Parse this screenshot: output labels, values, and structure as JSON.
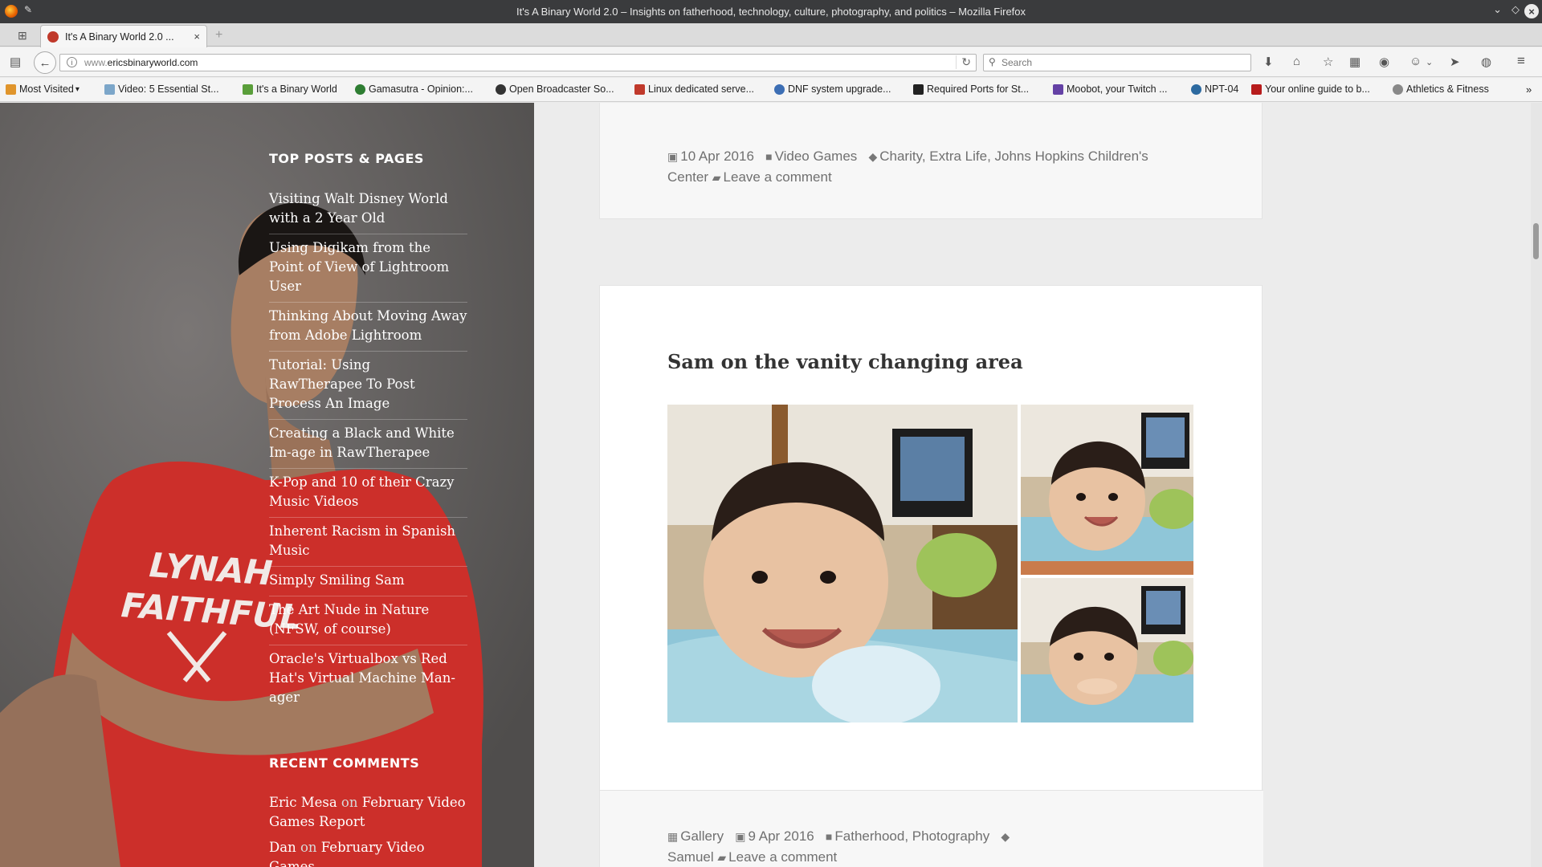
{
  "window": {
    "title": "It's A Binary World 2.0 – Insights on fatherhood, technology, culture, photography, and politics – Mozilla Firefox"
  },
  "tabs": [
    {
      "label": "It's A Binary World 2.0 ...",
      "close": "×"
    }
  ],
  "navbar": {
    "url_prefix": "www.",
    "url_domain": "ericsbinaryworld.com",
    "search_placeholder": "Search"
  },
  "bookmarks": [
    {
      "label": "Most Visited",
      "color": "#e0952c"
    },
    {
      "label": "Video: 5 Essential St...",
      "color": "#7ca6c9"
    },
    {
      "label": "It's a Binary World",
      "color": "#5a9e3a"
    },
    {
      "label": "Gamasutra - Opinion:...",
      "color": "#2e7d32"
    },
    {
      "label": "Open Broadcaster So...",
      "color": "#333333"
    },
    {
      "label": "Linux dedicated serve...",
      "color": "#c0392b"
    },
    {
      "label": "DNF system upgrade...",
      "color": "#3c6eb4"
    },
    {
      "label": "Required Ports for St...",
      "color": "#222222"
    },
    {
      "label": "Moobot, your Twitch ...",
      "color": "#6441a5"
    },
    {
      "label": "NPT-04",
      "color": "#2d6aa0"
    },
    {
      "label": "Your online guide to b...",
      "color": "#b71c1c"
    },
    {
      "label": "Athletics & Fitness",
      "color": "#888888"
    }
  ],
  "sidebar": {
    "top_posts_title": "TOP POSTS & PAGES",
    "top_posts": [
      "Visiting Walt Disney World with a 2 Year Old",
      "Using Digikam from the Point of View of Lightroom User",
      "Thinking About Moving Away from Adobe Lightroom",
      "Tutorial: Using RawTherapee To Post Process An Image",
      "Creating a Black and White Im-age in RawTherapee",
      "K-Pop and 10 of their Crazy Music Videos",
      "Inherent Racism in Spanish Music",
      "Simply Smiling Sam",
      "The Art Nude in Nature (NFSW, of course)",
      "Oracle's Virtualbox vs Red Hat's Virtual Machine Man-ager"
    ],
    "recent_comments_title": "RECENT COMMENTS",
    "recent_comments": [
      {
        "author": "Eric Mesa",
        "on": "on",
        "post": "February Video Games Report"
      },
      {
        "author": "Dan",
        "on": "on",
        "post": "February Video Games"
      }
    ],
    "shirt_text_1": "LYNAH",
    "shirt_text_2": "FAITHFUL"
  },
  "prev_post_meta": {
    "date": "10 Apr 2016",
    "category": "Video Games",
    "tags": "Charity, Extra Life, Johns Hopkins Children's Center",
    "comment": "Leave a comment"
  },
  "post": {
    "title": "Sam on the vanity changing area",
    "format": "Gallery",
    "date": "9 Apr 2016",
    "categories": "Fatherhood, Photography",
    "tags": "Samuel",
    "comment": "Leave a comment"
  }
}
